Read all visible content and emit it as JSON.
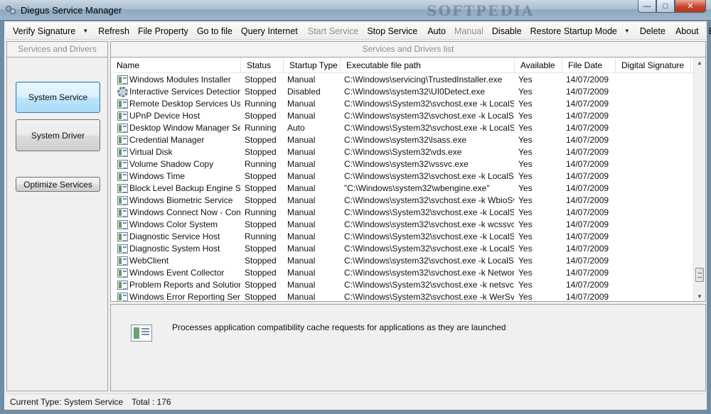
{
  "window": {
    "title": "Diegus Service Manager",
    "watermark": "SOFTPEDIA",
    "buttons": [
      "minimize",
      "maximize",
      "close"
    ]
  },
  "menu": {
    "items": [
      {
        "label": "Verify Signature",
        "enabled": true,
        "dropdown": true
      },
      {
        "label": "Refresh",
        "enabled": true
      },
      {
        "label": "File Property",
        "enabled": true
      },
      {
        "label": "Go to file",
        "enabled": true
      },
      {
        "label": "Query Internet",
        "enabled": true
      },
      {
        "label": "Start Service",
        "enabled": false
      },
      {
        "label": "Stop Service",
        "enabled": true
      },
      {
        "label": "Auto",
        "enabled": true
      },
      {
        "label": "Manual",
        "enabled": false
      },
      {
        "label": "Disable",
        "enabled": true
      },
      {
        "label": "Restore Startup Mode",
        "enabled": true,
        "dropdown": true
      },
      {
        "label": "Delete",
        "enabled": true
      },
      {
        "label": "About",
        "enabled": true
      },
      {
        "label": "Exit",
        "enabled": true
      }
    ]
  },
  "left_panel": {
    "header": "Services and Drivers",
    "system_service_label": "System Service",
    "system_driver_label": "System Driver",
    "optimize_label": "Optimize Services"
  },
  "list": {
    "header": "Services and Drivers list",
    "columns": [
      "Name",
      "Status",
      "Startup Type",
      "Executable file path",
      "Available",
      "File Date",
      "Digital Signature"
    ],
    "rows": [
      {
        "name": "Windows Modules Installer",
        "status": "Stopped",
        "startup": "Manual",
        "path": "C:\\Windows\\servicing\\TrustedInstaller.exe",
        "available": "Yes",
        "date": "14/07/2009",
        "signature": "",
        "icon": "service-icon"
      },
      {
        "name": "Interactive Services Detection",
        "status": "Stopped",
        "startup": "Disabled",
        "path": "C:\\Windows\\system32\\UI0Detect.exe",
        "available": "Yes",
        "date": "14/07/2009",
        "signature": "",
        "icon": "gear-icon"
      },
      {
        "name": "Remote Desktop Services Use...",
        "status": "Running",
        "startup": "Manual",
        "path": "C:\\Windows\\System32\\svchost.exe -k LocalS...",
        "available": "Yes",
        "date": "14/07/2009",
        "signature": "",
        "icon": "service-icon"
      },
      {
        "name": "UPnP Device Host",
        "status": "Stopped",
        "startup": "Manual",
        "path": "C:\\Windows\\system32\\svchost.exe -k LocalSe...",
        "available": "Yes",
        "date": "14/07/2009",
        "signature": "",
        "icon": "service-icon"
      },
      {
        "name": "Desktop Window Manager Se...",
        "status": "Running",
        "startup": "Auto",
        "path": "C:\\Windows\\System32\\svchost.exe -k LocalS...",
        "available": "Yes",
        "date": "14/07/2009",
        "signature": "",
        "icon": "service-icon"
      },
      {
        "name": "Credential Manager",
        "status": "Stopped",
        "startup": "Manual",
        "path": "C:\\Windows\\system32\\lsass.exe",
        "available": "Yes",
        "date": "14/07/2009",
        "signature": "",
        "icon": "service-icon"
      },
      {
        "name": "Virtual Disk",
        "status": "Stopped",
        "startup": "Manual",
        "path": "C:\\Windows\\System32\\vds.exe",
        "available": "Yes",
        "date": "14/07/2009",
        "signature": "",
        "icon": "service-icon"
      },
      {
        "name": "Volume Shadow Copy",
        "status": "Running",
        "startup": "Manual",
        "path": "C:\\Windows\\system32\\vssvc.exe",
        "available": "Yes",
        "date": "14/07/2009",
        "signature": "",
        "icon": "service-icon"
      },
      {
        "name": "Windows Time",
        "status": "Stopped",
        "startup": "Manual",
        "path": "C:\\Windows\\system32\\svchost.exe -k LocalSe...",
        "available": "Yes",
        "date": "14/07/2009",
        "signature": "",
        "icon": "service-icon"
      },
      {
        "name": "Block Level Backup Engine S...",
        "status": "Stopped",
        "startup": "Manual",
        "path": "\"C:\\Windows\\system32\\wbengine.exe\"",
        "available": "Yes",
        "date": "14/07/2009",
        "signature": "",
        "icon": "service-icon"
      },
      {
        "name": "Windows Biometric Service",
        "status": "Stopped",
        "startup": "Manual",
        "path": "C:\\Windows\\system32\\svchost.exe -k WbioSv...",
        "available": "Yes",
        "date": "14/07/2009",
        "signature": "",
        "icon": "service-icon"
      },
      {
        "name": "Windows Connect Now - Confi...",
        "status": "Running",
        "startup": "Manual",
        "path": "C:\\Windows\\System32\\svchost.exe -k LocalS...",
        "available": "Yes",
        "date": "14/07/2009",
        "signature": "",
        "icon": "service-icon"
      },
      {
        "name": "Windows Color System",
        "status": "Stopped",
        "startup": "Manual",
        "path": "C:\\Windows\\system32\\svchost.exe -k wcssvc",
        "available": "Yes",
        "date": "14/07/2009",
        "signature": "",
        "icon": "service-icon"
      },
      {
        "name": "Diagnostic Service Host",
        "status": "Running",
        "startup": "Manual",
        "path": "C:\\Windows\\System32\\svchost.exe -k LocalS...",
        "available": "Yes",
        "date": "14/07/2009",
        "signature": "",
        "icon": "service-icon"
      },
      {
        "name": "Diagnostic System Host",
        "status": "Stopped",
        "startup": "Manual",
        "path": "C:\\Windows\\System32\\svchost.exe -k LocalS...",
        "available": "Yes",
        "date": "14/07/2009",
        "signature": "",
        "icon": "service-icon"
      },
      {
        "name": "WebClient",
        "status": "Stopped",
        "startup": "Manual",
        "path": "C:\\Windows\\system32\\svchost.exe -k LocalSe...",
        "available": "Yes",
        "date": "14/07/2009",
        "signature": "",
        "icon": "service-icon"
      },
      {
        "name": "Windows Event Collector",
        "status": "Stopped",
        "startup": "Manual",
        "path": "C:\\Windows\\system32\\svchost.exe -k Networ...",
        "available": "Yes",
        "date": "14/07/2009",
        "signature": "",
        "icon": "service-icon"
      },
      {
        "name": "Problem Reports and Solutions...",
        "status": "Stopped",
        "startup": "Manual",
        "path": "C:\\Windows\\System32\\svchost.exe -k netsvcs",
        "available": "Yes",
        "date": "14/07/2009",
        "signature": "",
        "icon": "service-icon"
      },
      {
        "name": "Windows Error Reporting Servi...",
        "status": "Stopped",
        "startup": "Manual",
        "path": "C:\\Windows\\System32\\svchost.exe -k WerSv...",
        "available": "Yes",
        "date": "14/07/2009",
        "signature": "",
        "icon": "service-icon"
      }
    ]
  },
  "detail": {
    "description": "Processes application compatibility cache requests for applications as they are launched"
  },
  "status": {
    "current_type": "Current Type: System Service",
    "total": "Total : 176"
  }
}
